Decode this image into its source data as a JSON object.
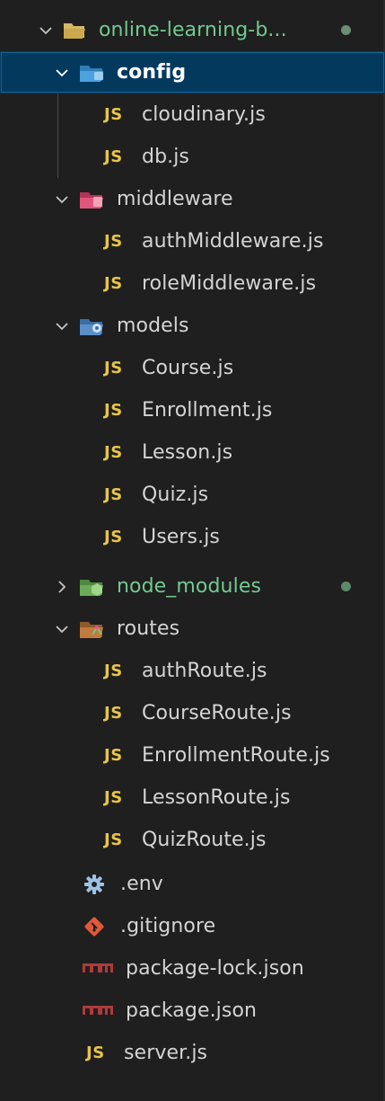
{
  "explorer": {
    "root": {
      "label": "online-learning-b...",
      "status": "modified-dot"
    },
    "tree": [
      {
        "kind": "folder",
        "label": "config",
        "expanded": true,
        "selected": true,
        "icon": "config-folder-icon",
        "depth": 1
      },
      {
        "kind": "js",
        "label": "cloudinary.js",
        "depth": 2
      },
      {
        "kind": "js",
        "label": "db.js",
        "depth": 2
      },
      {
        "kind": "folder",
        "label": "middleware",
        "expanded": true,
        "icon": "middleware-folder-icon",
        "depth": 1
      },
      {
        "kind": "js",
        "label": "authMiddleware.js",
        "depth": 2
      },
      {
        "kind": "js",
        "label": "roleMiddleware.js",
        "depth": 2
      },
      {
        "kind": "folder",
        "label": "models",
        "expanded": true,
        "icon": "models-folder-icon",
        "depth": 1
      },
      {
        "kind": "js",
        "label": "Course.js",
        "depth": 2
      },
      {
        "kind": "js",
        "label": "Enrollment.js",
        "depth": 2
      },
      {
        "kind": "js",
        "label": "Lesson.js",
        "depth": 2
      },
      {
        "kind": "js",
        "label": "Quiz.js",
        "depth": 2
      },
      {
        "kind": "js",
        "label": "Users.js",
        "depth": 2
      },
      {
        "kind": "folder",
        "label": "node_modules",
        "expanded": false,
        "icon": "node-modules-folder-icon",
        "depth": 1,
        "ignored": true
      },
      {
        "kind": "folder",
        "label": "routes",
        "expanded": true,
        "icon": "routes-folder-icon",
        "depth": 1
      },
      {
        "kind": "js",
        "label": "authRoute.js",
        "depth": 2
      },
      {
        "kind": "js",
        "label": "CourseRoute.js",
        "depth": 2
      },
      {
        "kind": "js",
        "label": "EnrollmentRoute.js",
        "depth": 2
      },
      {
        "kind": "js",
        "label": "LessonRoute.js",
        "depth": 2
      },
      {
        "kind": "js",
        "label": "QuizRoute.js",
        "depth": 2
      },
      {
        "kind": "file",
        "label": ".env",
        "icon": "gear-icon",
        "depth": 1
      },
      {
        "kind": "file",
        "label": ".gitignore",
        "icon": "git-icon",
        "depth": 1
      },
      {
        "kind": "file",
        "label": "package-lock.json",
        "icon": "npm-icon",
        "depth": 1
      },
      {
        "kind": "file",
        "label": "package.json",
        "icon": "npm-icon",
        "depth": 1
      },
      {
        "kind": "js",
        "label": "server.js",
        "depth": 1
      }
    ],
    "js_badge": "JS",
    "colors": {
      "background": "#1f1f1f",
      "selection": "#04395e",
      "selection_border": "#0e639c",
      "git_modified": "#73c991",
      "js_badge": "#e8c547",
      "text": "#d4d4d4"
    }
  }
}
